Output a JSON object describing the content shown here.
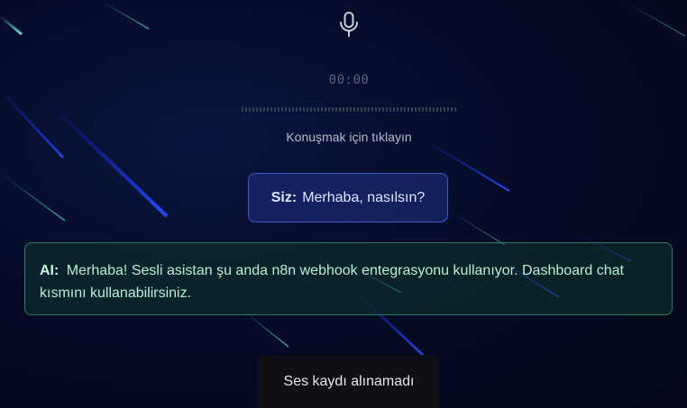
{
  "recorder": {
    "mic_icon": "microphone-icon",
    "timer": "00:00",
    "hint": "Konuşmak için tıklayın"
  },
  "messages": {
    "user": {
      "speaker": "Siz:",
      "text": "Merhaba, nasılsın?"
    },
    "ai": {
      "speaker": "AI:",
      "text": "Merhaba! Sesli asistan şu anda n8n webhook entegrasyonu kullanıyor. Dashboard chat kısmını kullanabilirsiniz."
    }
  },
  "toast": {
    "text": "Ses kaydı alınamadı"
  },
  "colors": {
    "background": "#050a1f",
    "user_border": "#4356c4",
    "ai_border": "#2f7a60",
    "streak_blue": "#2a4bff",
    "streak_cyan": "#3fc7e6"
  }
}
